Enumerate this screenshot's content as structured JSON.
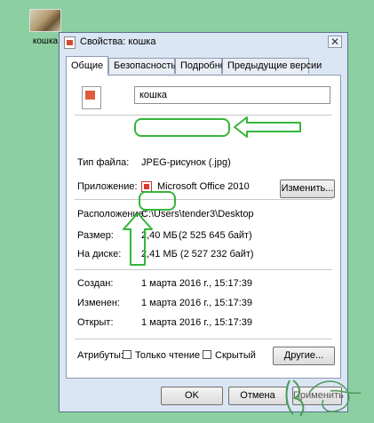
{
  "desktop": {
    "icon_label": "кошка"
  },
  "window": {
    "title": "Свойства: кошка",
    "close_glyph": "✕",
    "tabs": [
      "Общие",
      "Безопасность",
      "Подробно",
      "Предыдущие версии"
    ],
    "file_name": "кошка",
    "fields": {
      "type_label": "Тип файла:",
      "type_value": "JPEG-рисунок (.jpg)",
      "app_label": "Приложение:",
      "app_value": "Microsoft Office 2010",
      "change_button": "Изменить...",
      "location_label": "Расположение:",
      "location_value": "C:\\Users\\tender3\\Desktop",
      "size_label": "Размер:",
      "size_value_main": "2,40 МБ",
      "size_value_bytes": "(2 525 645 байт)",
      "disk_label": "На диске:",
      "disk_value": "2,41 МБ (2 527 232 байт)",
      "created_label": "Создан:",
      "created_value": "1 марта 2016 г., 15:17:39",
      "modified_label": "Изменен:",
      "modified_value": "1 марта 2016 г., 15:17:39",
      "opened_label": "Открыт:",
      "opened_value": "1 марта 2016 г., 15:17:39",
      "attributes_label": "Атрибуты:",
      "readonly_label": "Только чтение",
      "hidden_label": "Скрытый",
      "other_button": "Другие..."
    },
    "buttons": {
      "ok": "OK",
      "cancel": "Отмена",
      "apply": "Применить"
    }
  },
  "annotation_color": "#35b53a"
}
